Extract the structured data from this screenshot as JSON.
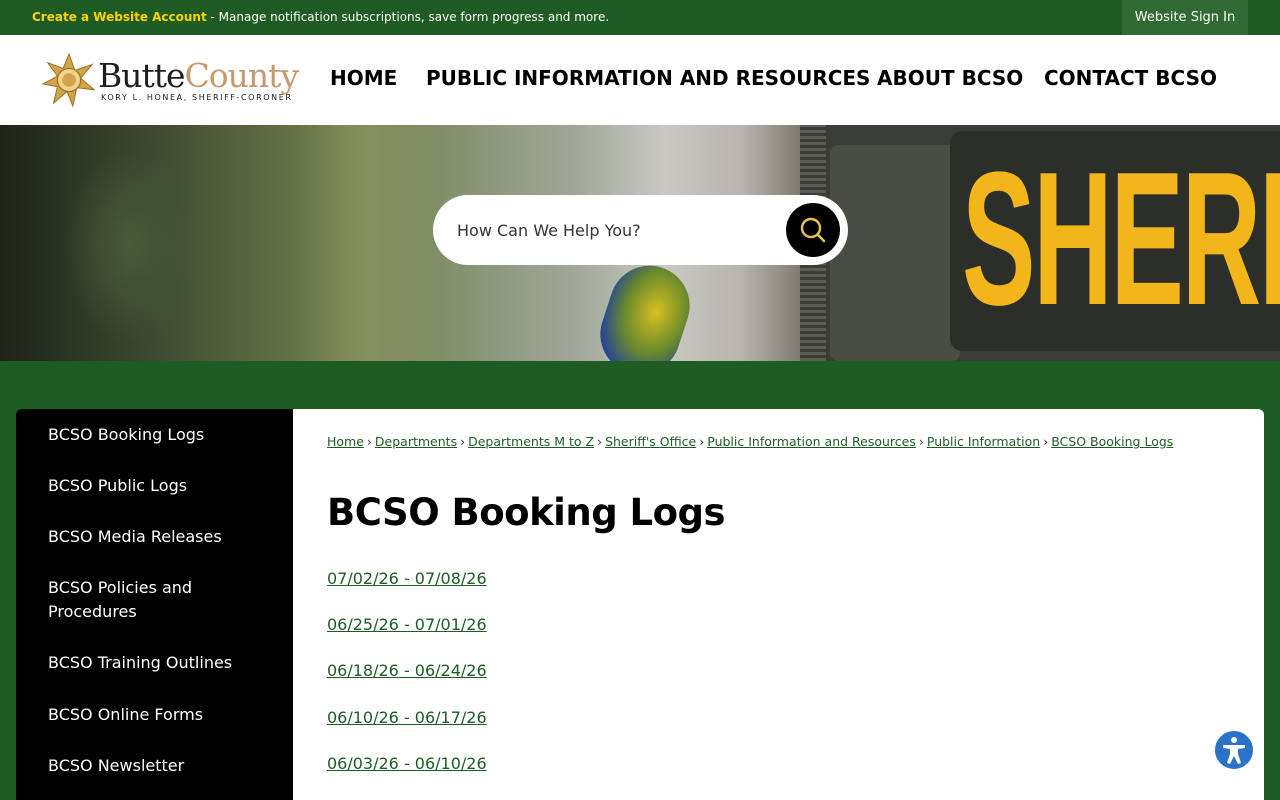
{
  "topbar": {
    "account_link": "Create a Website Account",
    "account_message": " - Manage notification subscriptions, save form progress and more.",
    "signin_label": "Website Sign In"
  },
  "logo": {
    "title_part1": "Butte",
    "title_part2": "County",
    "subtitle": "KORY L. HONEA, SHERIFF-CORONER"
  },
  "nav": {
    "items": [
      {
        "label": "HOME"
      },
      {
        "label": "PUBLIC INFORMATION AND RESOURCES"
      },
      {
        "label": "ABOUT BCSO"
      },
      {
        "label": "CONTACT BCSO"
      }
    ]
  },
  "hero": {
    "patch_text": "SHERIFF"
  },
  "search": {
    "placeholder": "How Can We Help You?",
    "icon": "search-icon"
  },
  "sidebar": {
    "items": [
      {
        "label": "BCSO Booking Logs"
      },
      {
        "label": "BCSO Public Logs"
      },
      {
        "label": "BCSO Media Releases"
      },
      {
        "label": "BCSO Policies and Procedures"
      },
      {
        "label": "BCSO Training Outlines"
      },
      {
        "label": "BCSO Online Forms"
      },
      {
        "label": "BCSO Newsletter"
      }
    ]
  },
  "breadcrumb": {
    "items": [
      {
        "label": "Home"
      },
      {
        "label": "Departments"
      },
      {
        "label": "Departments M to Z"
      },
      {
        "label": "Sheriff's Office"
      },
      {
        "label": "Public Information and Resources"
      },
      {
        "label": "Public Information"
      },
      {
        "label": "BCSO Booking Logs"
      }
    ],
    "separator": "›"
  },
  "main": {
    "title": "BCSO Booking Logs",
    "logs": [
      {
        "label": "07/02/26 - 07/08/26"
      },
      {
        "label": "06/25/26 - 07/01/26"
      },
      {
        "label": "06/18/26 - 06/24/26"
      },
      {
        "label": "06/10/26 - 06/17/26"
      },
      {
        "label": "06/03/26 - 06/10/26"
      }
    ]
  },
  "colors": {
    "brand_green": "#1e5c23",
    "accent_yellow": "#ffd200",
    "logo_tan": "#c79a6d"
  },
  "accessibility": {
    "icon": "accessibility-icon"
  }
}
